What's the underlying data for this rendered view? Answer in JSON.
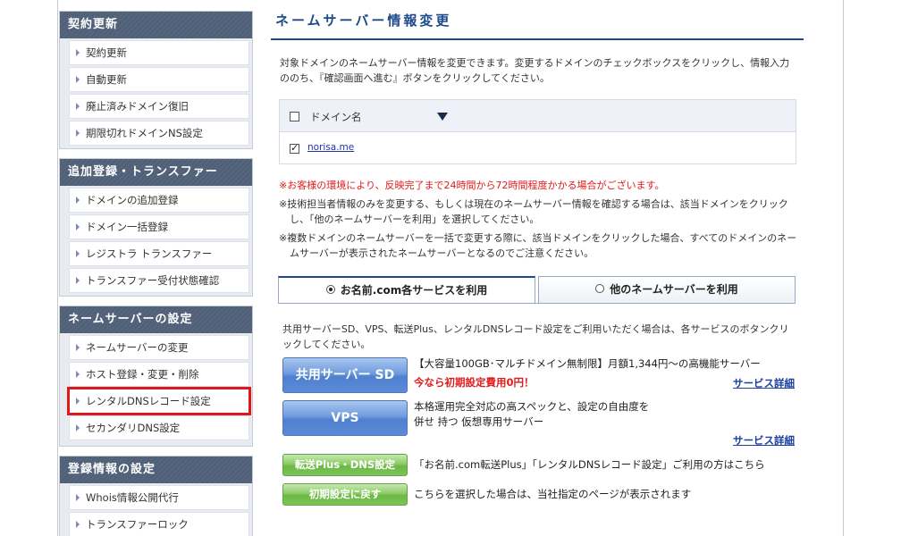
{
  "sidebar": {
    "sections": [
      {
        "title": "契約更新",
        "items": [
          "契約更新",
          "自動更新",
          "廃止済みドメイン復旧",
          "期限切れドメインNS設定"
        ]
      },
      {
        "title": "追加登録・トランスファー",
        "items": [
          "ドメインの追加登録",
          "ドメイン一括登録",
          "レジストラ トランスファー",
          "トランスファー受付状態確認"
        ]
      },
      {
        "title": "ネームサーバーの設定",
        "items": [
          "ネームサーバーの変更",
          "ホスト登録・変更・削除",
          "レンタルDNSレコード設定",
          "セカンダリDNS設定"
        ]
      },
      {
        "title": "登録情報の設定",
        "items": [
          "Whois情報公開代行",
          "トランスファーロック"
        ]
      }
    ]
  },
  "main": {
    "title": "ネームサーバー情報変更",
    "description": "対象ドメインのネームサーバー情報を変更できます。変更するドメインのチェックボックスをクリックし、情報入力ののち、『確認画面へ進む』ボタンをクリックしてください。",
    "table": {
      "column_header": "ドメイン名",
      "rows": [
        {
          "domain": "norisa.me",
          "checked": true
        }
      ]
    },
    "notes": {
      "red": "※お客様の環境により、反映完了まで24時間から72時間程度かかる場合がございます。",
      "note1": "※技術担当者情報のみを変更する、もしくは現在のネームサーバー情報を確認する場合は、該当ドメインをクリックし、「他のネームサーバーを利用」を選択してください。",
      "note2": "※複数ドメインのネームサーバーを一括で変更する際に、該当ドメインをクリックした場合、すべてのドメインのネームサーバーが表示されたネームサーバーとなるのでご注意ください。"
    },
    "tabs": {
      "active": "お名前.com各サービスを利用",
      "inactive": "他のネームサーバーを利用"
    },
    "services": {
      "intro": "共用サーバーSD、VPS、転送Plus、レンタルDNSレコード設定をご利用いただく場合は、各サービスのボタンクリックしてください。",
      "sd_button": "共用サーバー SD",
      "sd_desc": "【大容量100GB･マルチドメイン無制限】月額1,344円～の高機能サーバー",
      "sd_promo": "今なら初期設定費用0円！",
      "sd_link": "サービス詳細",
      "vps_button": "VPS",
      "vps_desc": "本格運用完全対応の高スペックと、設定の自由度を併せ 持つ 仮想専用サーバー",
      "vps_link": "サービス詳細",
      "transfer_button": "転送Plus・DNS設定",
      "transfer_desc": "「お名前.com転送Plus」「レンタルDNSレコード設定」ご利用の方はこちら",
      "reset_button": "初期設定に戻す",
      "reset_desc": "こちらを選択した場合は、当社指定のページが表示されます"
    }
  },
  "colors": {
    "accent_navy": "#1c4a8a",
    "sidebar_header": "#4f5f76",
    "highlight_red": "#e0171c",
    "button_blue": "#5c8bd6",
    "button_green": "#7cc456",
    "warning_red": "#e01b1b"
  }
}
